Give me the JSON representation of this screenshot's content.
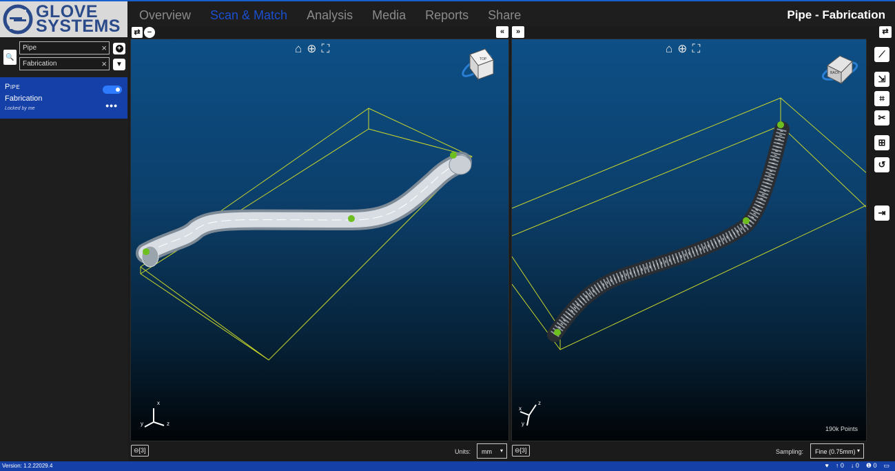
{
  "brand": {
    "line1": "GLOVE",
    "line2": "SYSTEMS"
  },
  "nav": {
    "tabs": [
      "Overview",
      "Scan & Match",
      "Analysis",
      "Media",
      "Reports",
      "Share"
    ],
    "active": "Scan & Match"
  },
  "window_title": "Pipe - Fabrication",
  "header_buttons": {
    "swap": "⇄",
    "minus": "−",
    "collapse_left": "«",
    "expand_right": "»",
    "swap_right": "⇄"
  },
  "search": {
    "field1_value": "Pipe",
    "field2_value": "Fabrication",
    "clear_glyph": "×",
    "add_glyph": "+",
    "filter_glyph": "▼",
    "search_glyph": "🔍"
  },
  "project": {
    "name": "Pipe",
    "subtitle": "Fabrication",
    "lock_status": "Locked by me",
    "more_glyph": "•••"
  },
  "left_viewport": {
    "tools": [
      "⌂",
      "⊕",
      "⛶"
    ],
    "camera_button": "⊖[3]",
    "units_label": "Units:",
    "units_value": "mm",
    "axes": {
      "x": "x",
      "y": "y",
      "z": "z"
    },
    "cube_face": "TOP"
  },
  "right_viewport": {
    "tools": [
      "⌂",
      "⊕",
      "⛶"
    ],
    "camera_button": "⊖[3]",
    "points_label": "190k Points",
    "sampling_label": "Sampling:",
    "sampling_value": "Fine (0.75mm)",
    "axes": {
      "x": "x",
      "y": "y",
      "z": "z"
    },
    "cube_face": "BACK"
  },
  "right_rail": {
    "buttons": [
      "⟋",
      "⇲",
      "⌗",
      "✂",
      "⊞",
      "↺",
      "⇥"
    ]
  },
  "status": {
    "version": "Version: 1.2.22029.4",
    "up_count": "↑ 0",
    "down_count": "↓ 0",
    "alert_count": "❶ 0"
  },
  "colors": {
    "accent": "#1540a8",
    "nav_active": "#1a4fd0",
    "bbox": "#cbd82a",
    "marker": "#6cbf1e"
  }
}
